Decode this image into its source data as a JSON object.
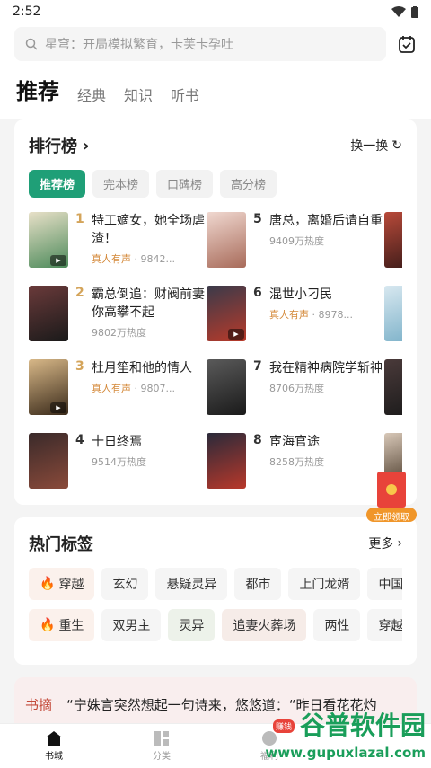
{
  "status": {
    "time": "2:52"
  },
  "search": {
    "placeholder": "星穹：开局模拟繁育，卡芙卡孕吐"
  },
  "tabs": [
    "推荐",
    "经典",
    "知识",
    "听书"
  ],
  "ranking": {
    "title": "排行榜",
    "refresh": "换一换",
    "chips": [
      "推荐榜",
      "完本榜",
      "口碑榜",
      "高分榜"
    ],
    "items": [
      {
        "num": "1",
        "title": "特工嫡女，她全场虐渣！",
        "voice": "真人有声",
        "meta": " · 9842..."
      },
      {
        "num": "5",
        "title": "唐总，离婚后请自重",
        "voice": "",
        "meta": "9409万热度"
      },
      {
        "num": "2",
        "title": "霸总倒追：财阀前妻你高攀不起",
        "voice": "",
        "meta": "9802万热度"
      },
      {
        "num": "6",
        "title": "混世小刁民",
        "voice": "真人有声",
        "meta": " · 8978..."
      },
      {
        "num": "3",
        "title": "杜月笙和他的情人",
        "voice": "真人有声",
        "meta": " · 9807..."
      },
      {
        "num": "7",
        "title": "我在精神病院学斩神",
        "voice": "",
        "meta": "8706万热度"
      },
      {
        "num": "4",
        "title": "十日终焉",
        "voice": "",
        "meta": "9514万热度"
      },
      {
        "num": "8",
        "title": "宦海官途",
        "voice": "",
        "meta": "8258万热度"
      }
    ]
  },
  "hot_tags": {
    "title": "热门标签",
    "more": "更多",
    "row1": [
      "穿越",
      "玄幻",
      "悬疑灵异",
      "都市",
      "上门龙婿",
      "中国名"
    ],
    "row2": [
      "重生",
      "双男主",
      "灵异",
      "追妻火葬场",
      "两性",
      "穿越"
    ]
  },
  "excerpt": {
    "label": "书摘",
    "text": "“宁姝言突然想起一句诗来，悠悠道：“昨日看花花灼"
  },
  "float": {
    "label": "立即领取"
  },
  "nav": {
    "items": [
      "书城",
      "分类",
      "福利"
    ],
    "badge": "赚钱"
  },
  "watermark": {
    "name": "谷普软件园",
    "url": "www.gupuxlazal.com"
  },
  "colors": {
    "accent": "#1f9f77",
    "gold": "#d4a45a",
    "voice": "#d4893a"
  }
}
